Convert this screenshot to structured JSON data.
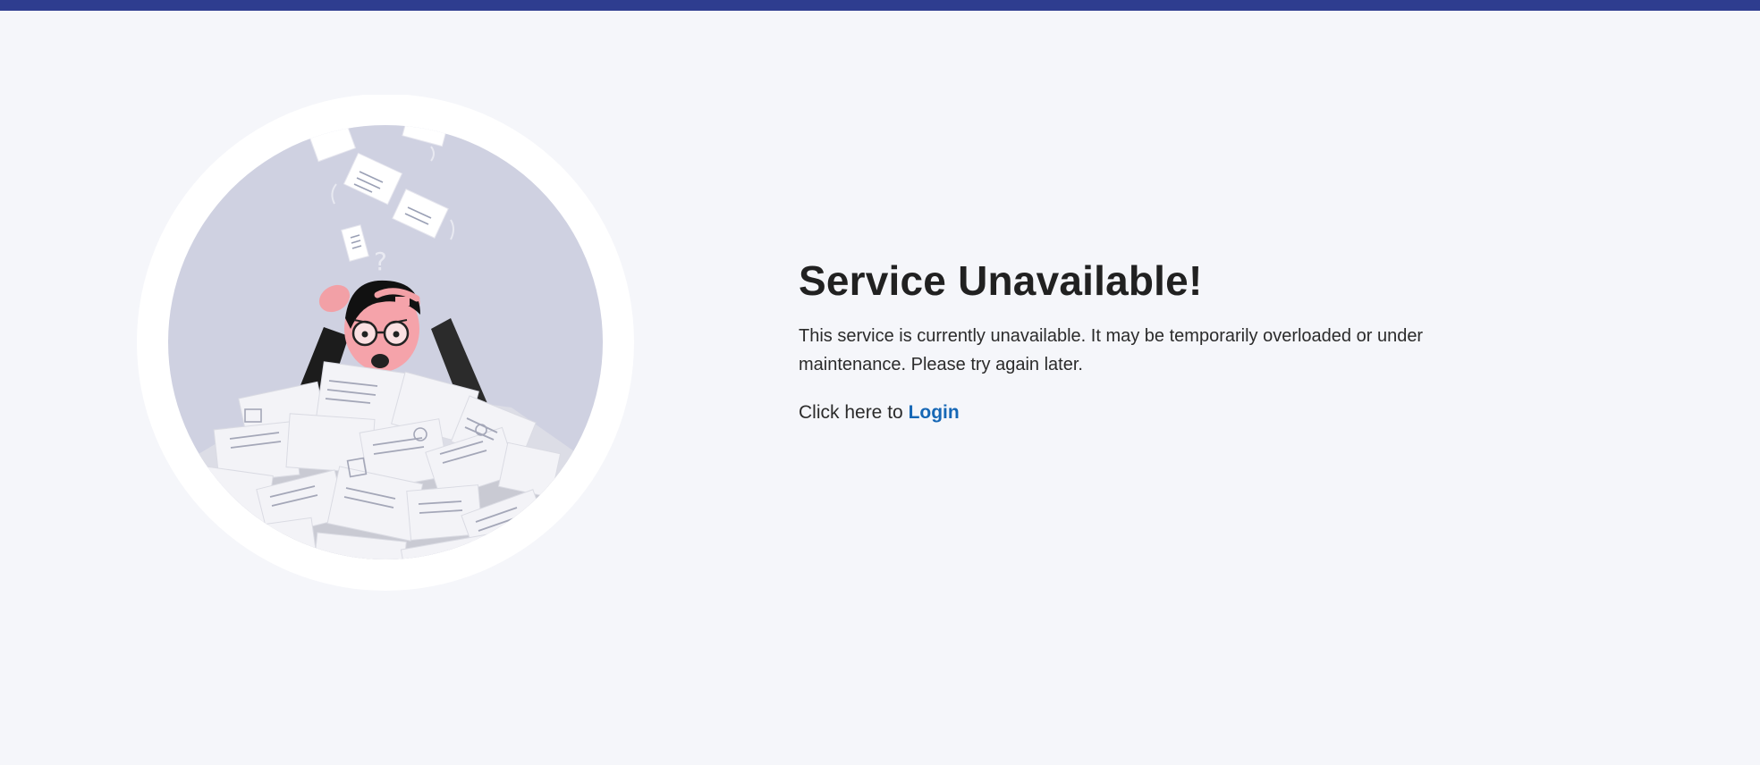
{
  "page": {
    "heading": "Service Unavailable!",
    "description": "This service is currently unavailable. It may be temporarily overloaded or under maintenance. Please try again later.",
    "login_prefix": "Click here to",
    "login_link": "Login"
  },
  "colors": {
    "top_bar": "#2e3d8f",
    "background": "#f5f6fa",
    "link": "#1667b5",
    "heading": "#212121"
  },
  "illustration": {
    "icon": "overwhelmed-person-with-papers-illustration"
  }
}
